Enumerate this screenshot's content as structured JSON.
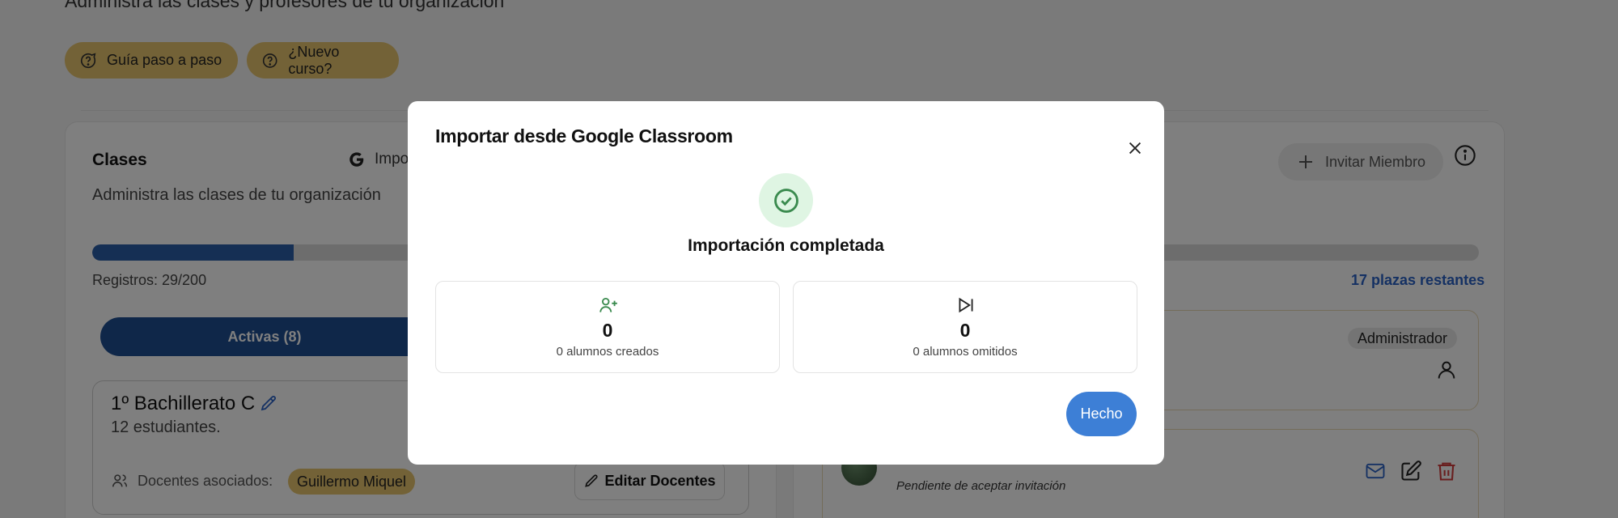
{
  "header": {
    "subtitle": "Administra las clases y profesores de tu organización",
    "guide_button": "Guía paso a paso",
    "new_course_button": "¿Nuevo curso?"
  },
  "classes_panel": {
    "title": "Clases",
    "import_label": "Impo",
    "description": "Administra las clases de tu organización",
    "progress_fraction": 0.145,
    "registros": "Registros: 29/200",
    "plazas": "17 plazas restantes",
    "active_tab": "Activas (8)",
    "class_card": {
      "name": "1º Bachillerato C",
      "students": "12 estudiantes.",
      "teachers_label": "Docentes asociados:",
      "teacher_chip": "Guillermo Miquel",
      "edit_teachers": "Editar Docentes"
    }
  },
  "members_panel": {
    "invite_button": "Invitar Miembro",
    "role_badge": "Administrador",
    "pending_text": "Pendiente de aceptar invitación"
  },
  "modal": {
    "title": "Importar desde Google Classroom",
    "status": "Importación completada",
    "created": {
      "value": "0",
      "label": "0 alumnos creados"
    },
    "skipped": {
      "value": "0",
      "label": "0 alumnos omitidos"
    },
    "done_button": "Hecho"
  },
  "colors": {
    "accent_blue": "#2a5fa8",
    "chip_yellow": "#e7c46e",
    "success_green": "#3a8a4e",
    "done_blue": "#3d7fd6"
  },
  "icons": [
    "help-circle-icon",
    "google-icon",
    "pencil-icon",
    "users-icon",
    "plus-icon",
    "info-icon",
    "person-icon",
    "mail-icon",
    "edit-icon",
    "trash-icon",
    "close-icon",
    "check-circle-icon",
    "user-plus-icon",
    "skip-forward-icon"
  ]
}
